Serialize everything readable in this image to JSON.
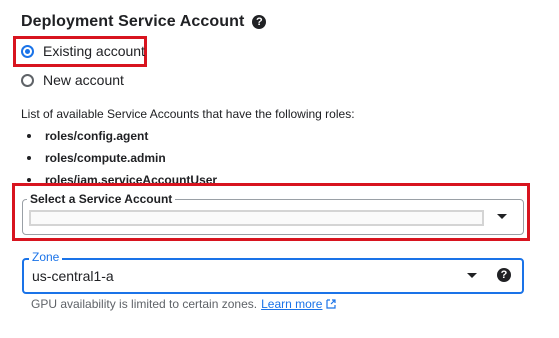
{
  "section": {
    "title": "Deployment Service Account",
    "help_icon": "help-circle-icon"
  },
  "account_type": {
    "options": [
      {
        "label": "Existing account",
        "selected": true
      },
      {
        "label": "New account",
        "selected": false
      }
    ]
  },
  "roles_info": {
    "description": "List of available Service Accounts that have the following roles:",
    "roles": [
      "roles/config.agent",
      "roles/compute.admin",
      "roles/iam.serviceAccountUser"
    ]
  },
  "service_account_select": {
    "label": "Select a Service Account",
    "value": ""
  },
  "zone_select": {
    "label": "Zone",
    "value": "us-central1-a",
    "hint": "GPU availability is limited to certain zones.",
    "learn_more": "Learn more",
    "help_icon": "help-circle-icon"
  },
  "colors": {
    "accent": "#1a73e8",
    "highlight": "#d8141f"
  }
}
